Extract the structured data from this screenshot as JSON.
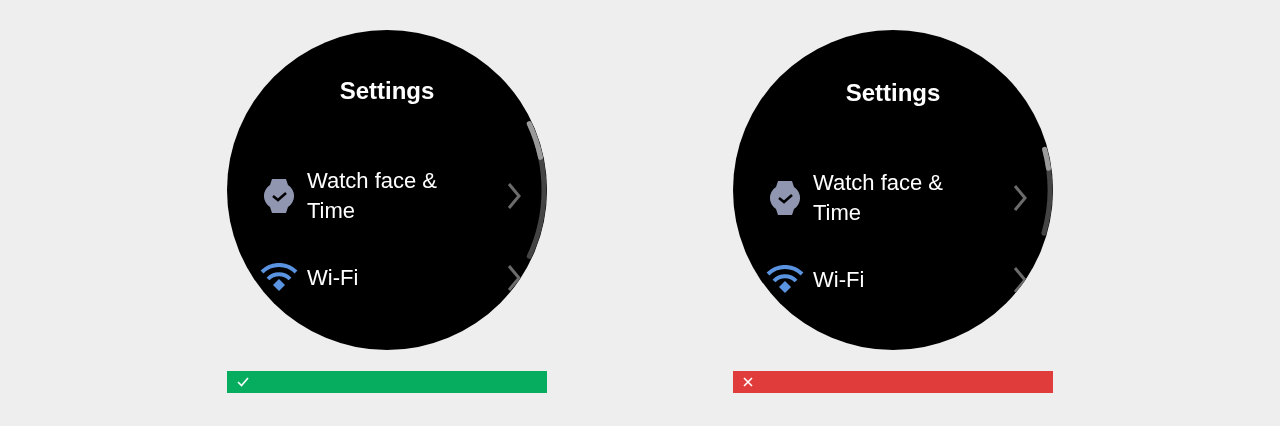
{
  "examples": [
    {
      "kind": "do",
      "screen": {
        "title": "Settings",
        "items": [
          {
            "kind": "watch",
            "label": "Watch face & Time"
          },
          {
            "kind": "wifi",
            "label": "Wi-Fi"
          }
        ]
      }
    },
    {
      "kind": "dont",
      "screen": {
        "title": "Settings",
        "items": [
          {
            "kind": "watch",
            "label": "Watch face & Time"
          },
          {
            "kind": "wifi",
            "label": "Wi-Fi"
          }
        ]
      }
    }
  ]
}
